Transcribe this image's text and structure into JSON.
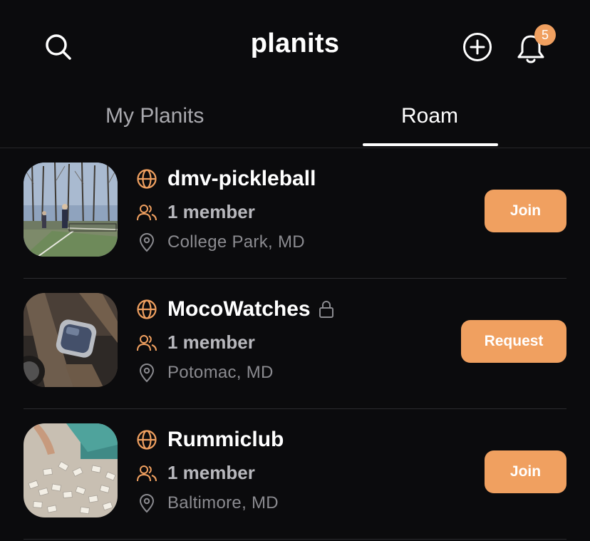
{
  "header": {
    "title": "planits",
    "notification_count": "5",
    "icons": {
      "search": "search-icon",
      "add": "plus-circle-icon",
      "bell": "bell-icon"
    }
  },
  "tabs": [
    {
      "label": "My Planits",
      "active": false
    },
    {
      "label": "Roam",
      "active": true
    }
  ],
  "groups": [
    {
      "name": "dmv-pickleball",
      "members": "1 member",
      "location": "College Park, MD",
      "action": "Join",
      "private": false
    },
    {
      "name": "MocoWatches",
      "members": "1 member",
      "location": "Potomac, MD",
      "action": "Request",
      "private": true
    },
    {
      "name": "Rummiclub",
      "members": "1 member",
      "location": "Baltimore, MD",
      "action": "Join",
      "private": false
    }
  ],
  "colors": {
    "accent": "#f0a060",
    "background": "#0b0b0d",
    "muted_text": "#8b8b90"
  }
}
